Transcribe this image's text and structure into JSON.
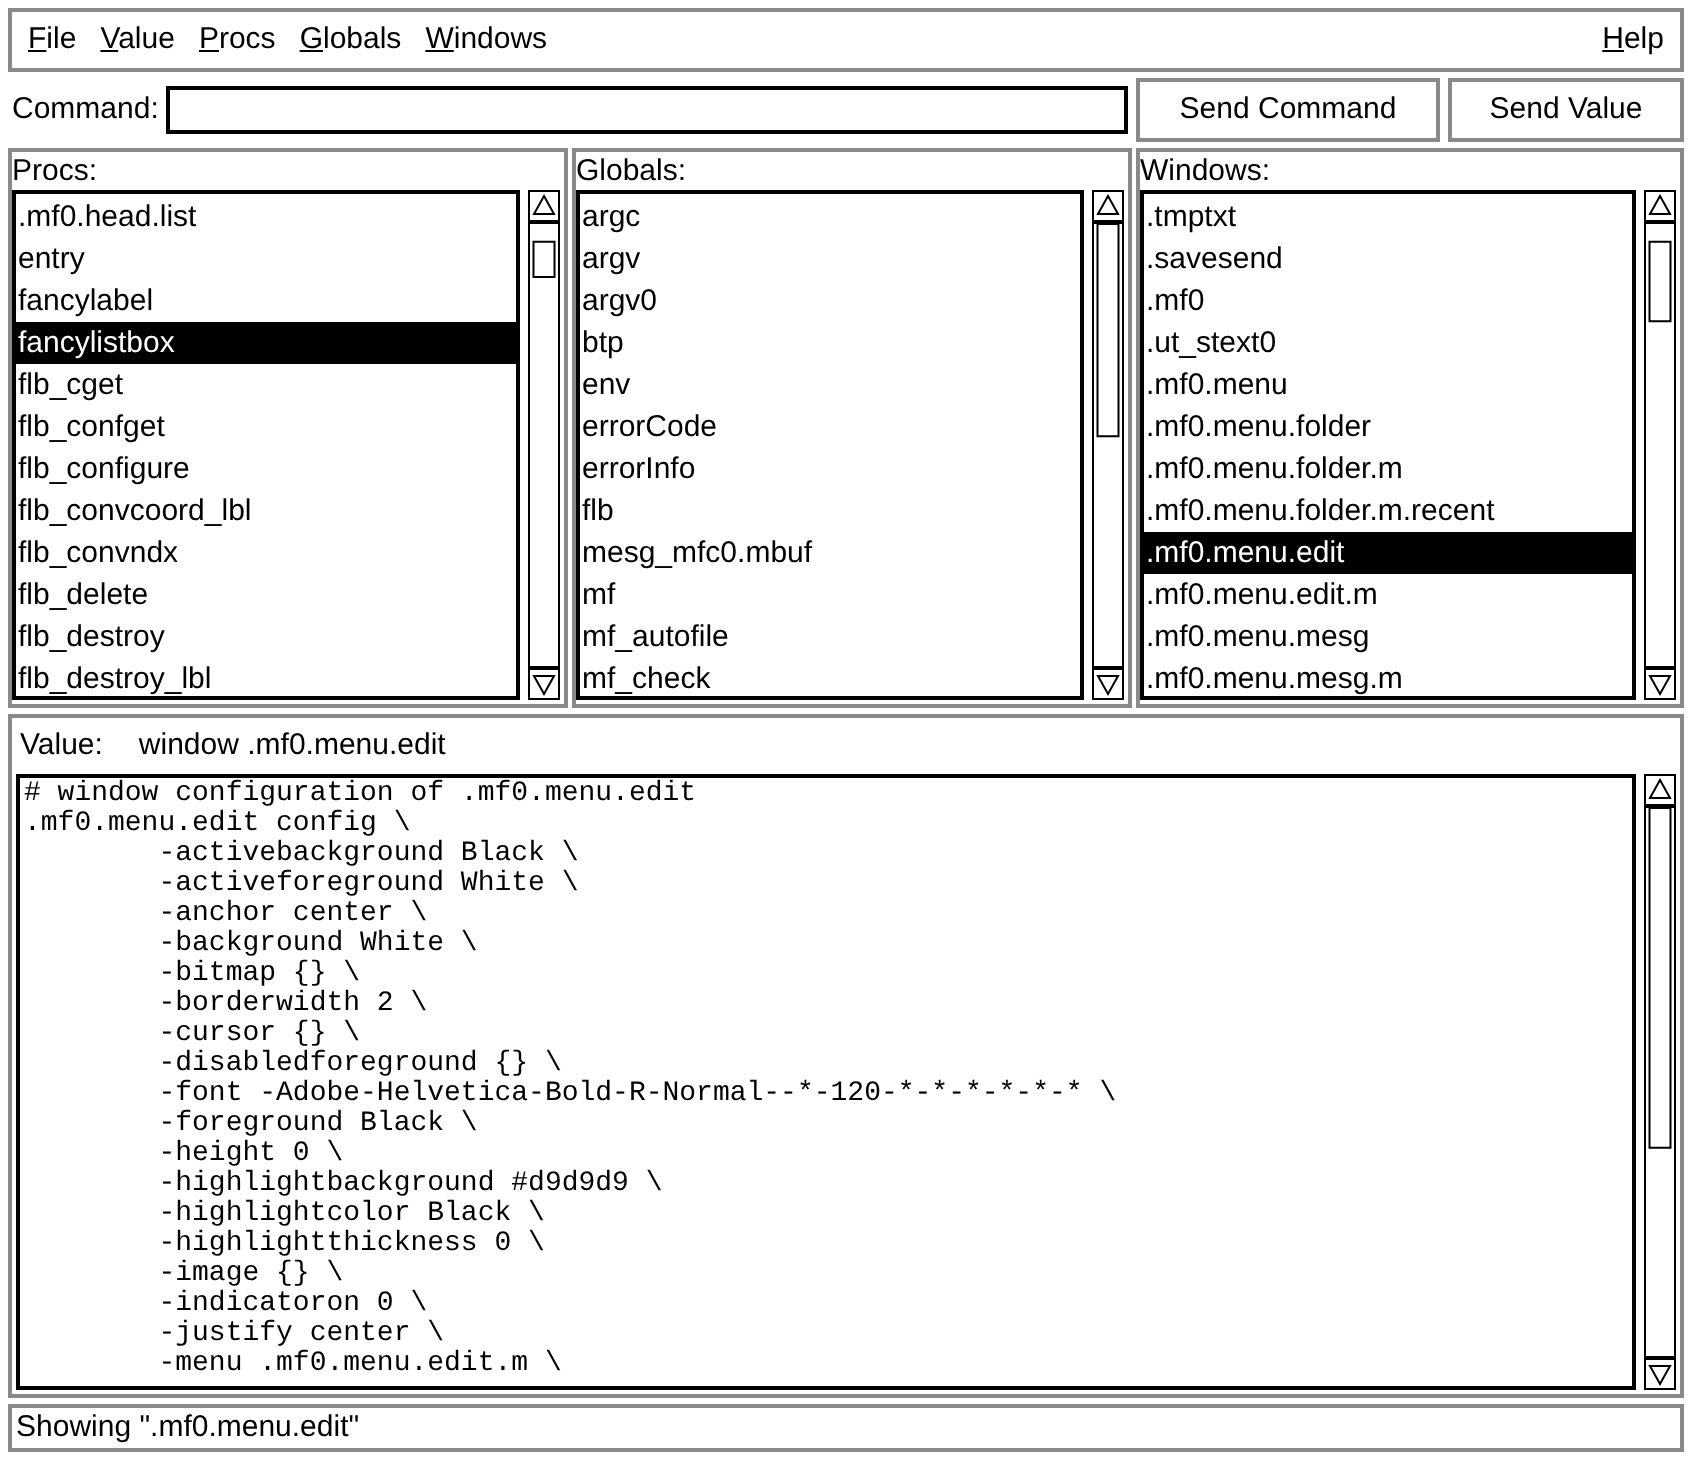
{
  "menu_bar": {
    "left": [
      "File",
      "Value",
      "Procs",
      "Globals",
      "Windows"
    ],
    "right": [
      "Help"
    ]
  },
  "command": {
    "label": "Command:"
  },
  "buttons": [
    "Send Command",
    "Send Value"
  ],
  "lists": [
    {
      "title": "Procs:",
      "items": [
        {
          "label": ".mf0.head.list",
          "selected": false
        },
        {
          "label": "entry",
          "selected": false
        },
        {
          "label": "fancylabel",
          "selected": false
        },
        {
          "label": "fancylistbox",
          "selected": true
        },
        {
          "label": "flb_cget",
          "selected": false
        },
        {
          "label": "flb_confget",
          "selected": false
        },
        {
          "label": "flb_configure",
          "selected": false
        },
        {
          "label": "flb_convcoord_lbl",
          "selected": false
        },
        {
          "label": "flb_convndx",
          "selected": false
        },
        {
          "label": "flb_delete",
          "selected": false
        },
        {
          "label": "flb_destroy",
          "selected": false
        },
        {
          "label": "flb_destroy_lbl",
          "selected": false
        }
      ]
    },
    {
      "title": "Globals:",
      "items": [
        {
          "label": "argc",
          "selected": false
        },
        {
          "label": "argv",
          "selected": false
        },
        {
          "label": "argv0",
          "selected": false
        },
        {
          "label": "btp",
          "selected": false
        },
        {
          "label": "env",
          "selected": false
        },
        {
          "label": "errorCode",
          "selected": false
        },
        {
          "label": "errorInfo",
          "selected": false
        },
        {
          "label": "flb",
          "selected": false
        },
        {
          "label": "mesg_mfc0.mbuf",
          "selected": false
        },
        {
          "label": "mf",
          "selected": false
        },
        {
          "label": "mf_autofile",
          "selected": false
        },
        {
          "label": "mf_check",
          "selected": false
        }
      ]
    },
    {
      "title": "Windows:",
      "items": [
        {
          "label": ".tmptxt",
          "selected": false
        },
        {
          "label": ".savesend",
          "selected": false
        },
        {
          "label": ".mf0",
          "selected": false
        },
        {
          "label": ".ut_stext0",
          "selected": false
        },
        {
          "label": ".mf0.menu",
          "selected": false
        },
        {
          "label": ".mf0.menu.folder",
          "selected": false
        },
        {
          "label": ".mf0.menu.folder.m",
          "selected": false
        },
        {
          "label": ".mf0.menu.folder.m.recent",
          "selected": false
        },
        {
          "label": ".mf0.menu.edit",
          "selected": true
        },
        {
          "label": ".mf0.menu.edit.m",
          "selected": false
        },
        {
          "label": ".mf0.menu.mesg",
          "selected": false
        },
        {
          "label": ".mf0.menu.mesg.m",
          "selected": false
        }
      ]
    }
  ],
  "value": {
    "label": "Value:",
    "name": "window .mf0.menu.edit",
    "lines": [
      "# window configuration of .mf0.menu.edit",
      ".mf0.menu.edit config \\",
      "        -activebackground Black \\",
      "        -activeforeground White \\",
      "        -anchor center \\",
      "        -background White \\",
      "        -bitmap {} \\",
      "        -borderwidth 2 \\",
      "        -cursor {} \\",
      "        -disabledforeground {} \\",
      "        -font -Adobe-Helvetica-Bold-R-Normal--*-120-*-*-*-*-*-* \\",
      "        -foreground Black \\",
      "        -height 0 \\",
      "        -highlightbackground #d9d9d9 \\",
      "        -highlightcolor Black \\",
      "        -highlightthickness 0 \\",
      "        -image {} \\",
      "        -indicatoron 0 \\",
      "        -justify center \\",
      "        -menu .mf0.menu.edit.m \\"
    ]
  },
  "status_bar": "Showing \".mf0.menu.edit\""
}
